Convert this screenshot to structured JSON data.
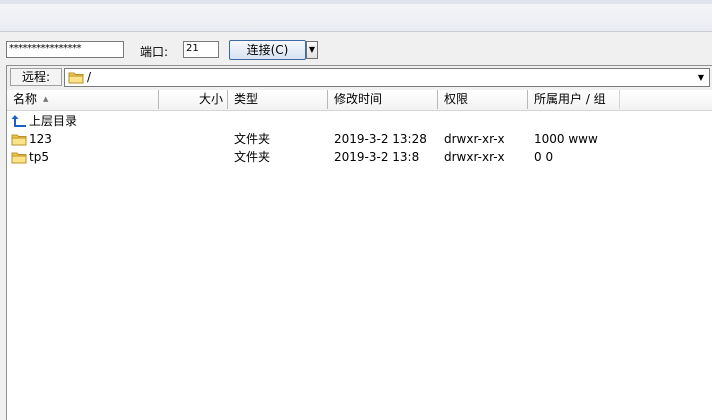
{
  "connection": {
    "password_value": "****************",
    "port_label": "端口:",
    "port_value": "21",
    "connect_label": "连接(C)",
    "connect_dropdown_icon": "chevron-down-icon"
  },
  "remote": {
    "label": "远程:",
    "path": "/"
  },
  "columns": {
    "name": "名称",
    "size": "大小",
    "type": "类型",
    "modified": "修改时间",
    "permissions": "权限",
    "owner": "所属用户 / 组"
  },
  "rows": [
    {
      "name": "上层目录",
      "icon": "parent-directory-icon",
      "size": "",
      "type": "",
      "modified": "",
      "permissions": "",
      "owner": ""
    },
    {
      "name": "123",
      "icon": "folder-icon",
      "size": "",
      "type": "文件夹",
      "modified": "2019-3-2 13:28",
      "permissions": "drwxr-xr-x",
      "owner": "1000 www"
    },
    {
      "name": "tp5",
      "icon": "folder-icon",
      "size": "",
      "type": "文件夹",
      "modified": "2019-3-2 13:8",
      "permissions": "drwxr-xr-x",
      "owner": "0 0"
    }
  ],
  "colors": {
    "folder": "#f3c74a",
    "parent_arrow": "#1a5fc8",
    "button_border": "#3d6aa5"
  }
}
